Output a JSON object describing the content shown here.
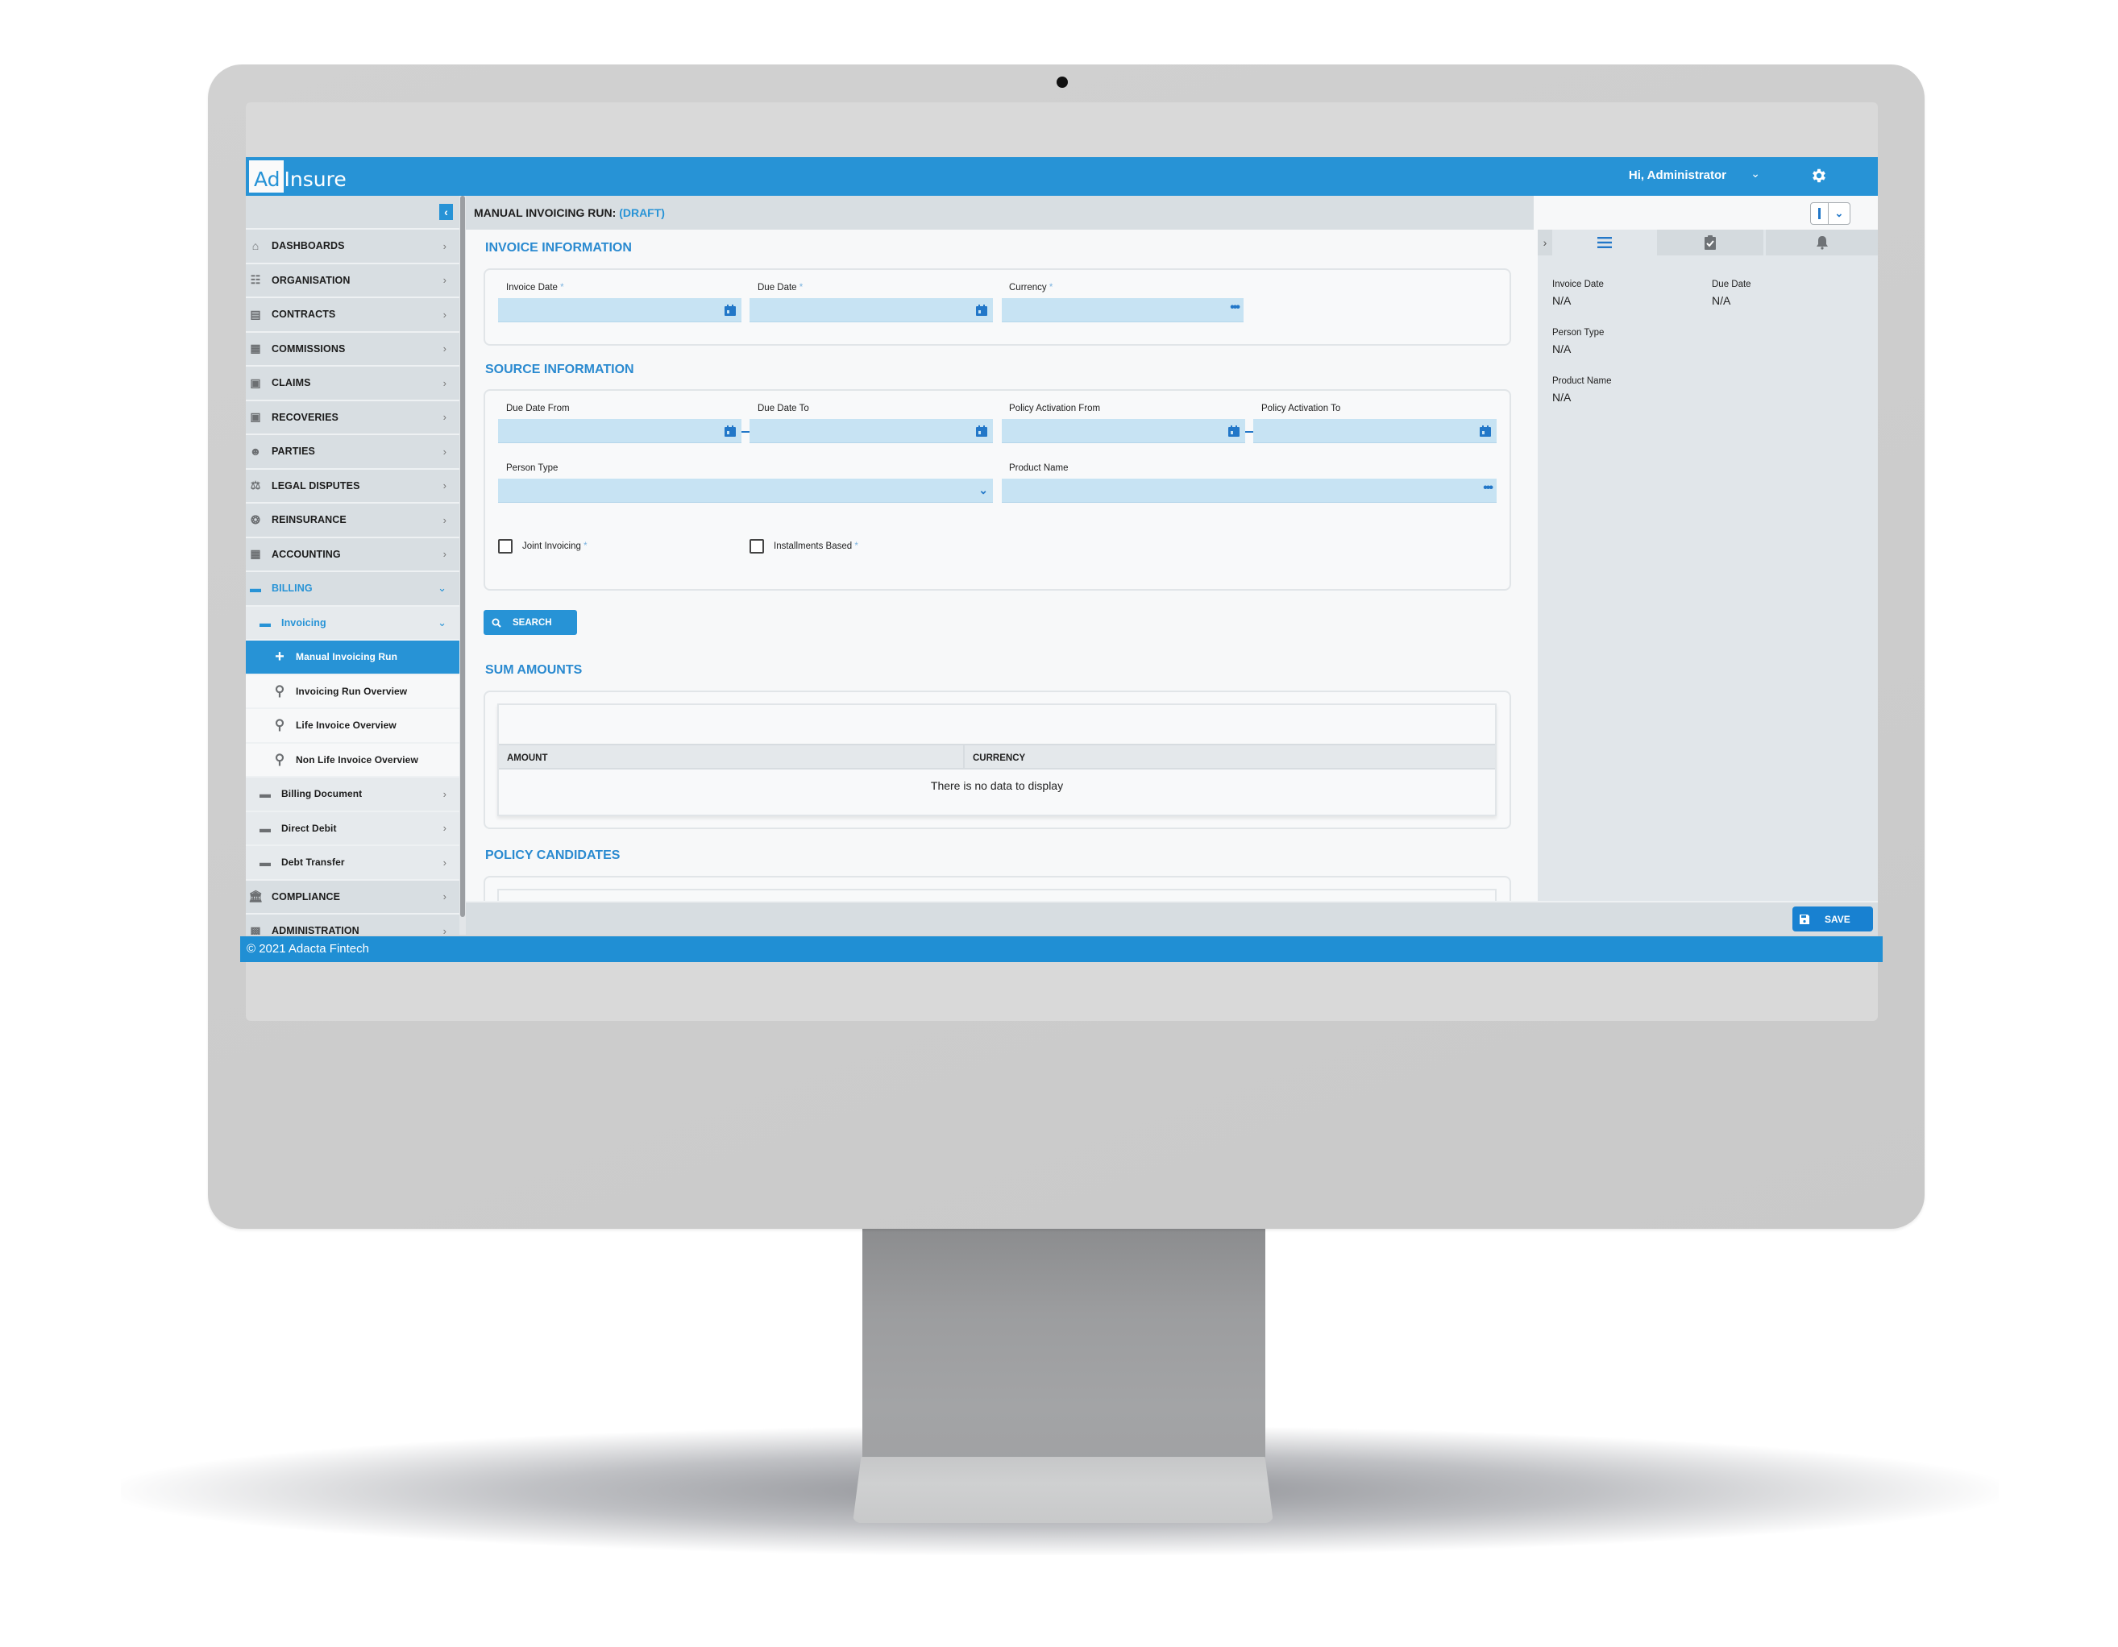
{
  "app": {
    "logo_part1": "Ad",
    "logo_part2": "Insure",
    "greeting": "Hi, Administrator",
    "brand_color": "#2793d6"
  },
  "sidebar": {
    "items": [
      {
        "label": "DASHBOARDS",
        "icon": "home-icon"
      },
      {
        "label": "ORGANISATION",
        "icon": "sitemap-icon"
      },
      {
        "label": "CONTRACTS",
        "icon": "contract-icon"
      },
      {
        "label": "COMMISSIONS",
        "icon": "calculator-icon"
      },
      {
        "label": "CLAIMS",
        "icon": "briefcase-icon"
      },
      {
        "label": "RECOVERIES",
        "icon": "briefcase-icon"
      },
      {
        "label": "PARTIES",
        "icon": "users-icon"
      },
      {
        "label": "LEGAL DISPUTES",
        "icon": "scale-icon"
      },
      {
        "label": "REINSURANCE",
        "icon": "lifebuoy-icon"
      },
      {
        "label": "ACCOUNTING",
        "icon": "calculator-icon"
      },
      {
        "label": "BILLING",
        "icon": "credit-card-icon",
        "expanded": true
      },
      {
        "label": "COMPLIANCE",
        "icon": "bank-icon"
      },
      {
        "label": "ADMINISTRATION",
        "icon": "admin-icon"
      }
    ],
    "billing_children": [
      {
        "label": "Invoicing",
        "expanded": true
      },
      {
        "label": "Billing Document"
      },
      {
        "label": "Direct Debit"
      },
      {
        "label": "Debt Transfer"
      }
    ],
    "invoicing_children": [
      {
        "label": "Manual Invoicing Run",
        "icon": "plus-icon",
        "selected": true
      },
      {
        "label": "Invoicing Run Overview",
        "icon": "search-icon"
      },
      {
        "label": "Life Invoice Overview",
        "icon": "search-icon"
      },
      {
        "label": "Non Life Invoice Overview",
        "icon": "search-icon"
      }
    ]
  },
  "page": {
    "title": "MANUAL INVOICING RUN:",
    "status": "(DRAFT)"
  },
  "invoice_info": {
    "title": "INVOICE INFORMATION",
    "fields": [
      {
        "label": "Invoice Date",
        "required": "*",
        "value": "",
        "type": "date"
      },
      {
        "label": "Due Date",
        "required": "*",
        "value": "",
        "type": "date"
      },
      {
        "label": "Currency",
        "required": "*",
        "value": "",
        "type": "lookup"
      }
    ]
  },
  "source_info": {
    "title": "SOURCE INFORMATION",
    "fields": [
      {
        "label": "Due Date From",
        "value": "",
        "type": "date"
      },
      {
        "label": "Due Date To",
        "value": "",
        "type": "date"
      },
      {
        "label": "Policy Activation From",
        "value": "",
        "type": "date"
      },
      {
        "label": "Policy Activation To",
        "value": "",
        "type": "date"
      },
      {
        "label": "Person Type",
        "value": "",
        "type": "select"
      },
      {
        "label": "Product Name",
        "value": "",
        "type": "lookup"
      }
    ],
    "checkboxes": [
      {
        "label": "Joint Invoicing",
        "required": "*",
        "checked": false
      },
      {
        "label": "Installments Based",
        "required": "*",
        "checked": false
      }
    ],
    "search_label": "SEARCH"
  },
  "sum_amounts": {
    "title": "SUM AMOUNTS",
    "columns": [
      "AMOUNT",
      "CURRENCY"
    ],
    "rows": [],
    "empty_text": "There is no data to display"
  },
  "policy_candidates": {
    "title": "POLICY CANDIDATES"
  },
  "summary_panel": {
    "tabs": [
      {
        "icon": "list-icon",
        "active": true
      },
      {
        "icon": "clipboard-check-icon",
        "active": false
      },
      {
        "icon": "bell-icon",
        "active": false
      }
    ],
    "items": [
      {
        "label": "Invoice Date",
        "value": "N/A"
      },
      {
        "label": "Due Date",
        "value": "N/A"
      },
      {
        "label": "Person Type",
        "value": "N/A"
      },
      {
        "label": "Product Name",
        "value": "N/A"
      }
    ]
  },
  "actions": {
    "save_label": "SAVE"
  },
  "footer": {
    "text": "© 2021 Adacta Fintech"
  }
}
